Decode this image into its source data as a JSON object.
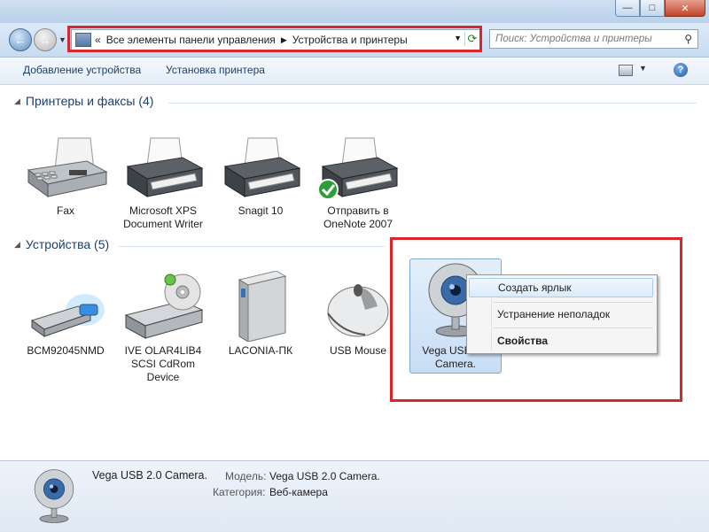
{
  "window": {
    "controls": {
      "minimize": "—",
      "maximize": "□",
      "close": "✕"
    }
  },
  "nav": {
    "back_icon": "back-arrow-icon",
    "forward_icon": "forward-arrow-icon",
    "breadcrumb_prefix": "«",
    "breadcrumb": [
      "Все элементы панели управления",
      "Устройства и принтеры"
    ],
    "search_placeholder": "Поиск: Устройства и принтеры"
  },
  "toolbar": {
    "add_device": "Добавление устройства",
    "add_printer": "Установка принтера",
    "help": "?"
  },
  "groups": {
    "printers": {
      "title": "Принтеры и факсы (4)"
    },
    "devices": {
      "title": "Устройства (5)"
    }
  },
  "printers": [
    {
      "label": "Fax",
      "icon": "fax-icon"
    },
    {
      "label": "Microsoft XPS Document Writer",
      "icon": "printer-icon"
    },
    {
      "label": "Snagit 10",
      "icon": "printer-icon"
    },
    {
      "label": "Отправить в OneNote 2007",
      "icon": "printer-default-icon"
    }
  ],
  "devices": [
    {
      "label": "BCM92045NMD",
      "icon": "usb-adapter-icon"
    },
    {
      "label": "IVE OLAR4LIB4 SCSI CdRom Device",
      "icon": "cdrom-icon"
    },
    {
      "label": "LACONIA-ПК",
      "icon": "computer-tower-icon"
    },
    {
      "label": "USB Mouse",
      "icon": "mouse-icon"
    },
    {
      "label": "Vega USB 2.0 Camera.",
      "icon": "webcam-icon"
    }
  ],
  "context_menu": {
    "items": [
      "Создать ярлык",
      "Устранение неполадок",
      "Свойства"
    ]
  },
  "details": {
    "name": "Vega USB 2.0 Camera.",
    "model_key": "Модель:",
    "model_value": "Vega USB 2.0 Camera.",
    "category_key": "Категория:",
    "category_value": "Веб-камера"
  },
  "colors": {
    "highlight": "#d8262d",
    "link": "#1e3f6c"
  }
}
